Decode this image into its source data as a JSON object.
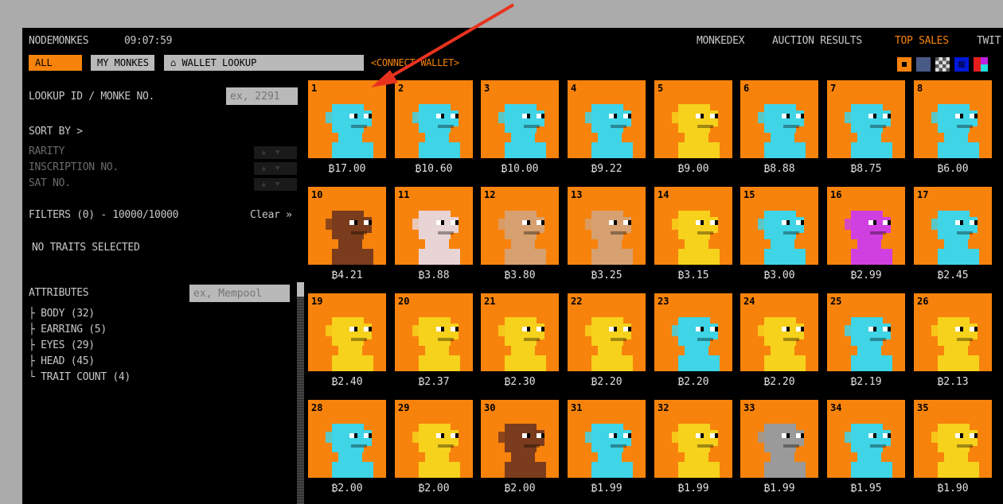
{
  "header": {
    "brand": "NODEMONKES",
    "clock": "09:07:59",
    "nav": [
      {
        "label": "MONKEDEX",
        "active": false
      },
      {
        "label": "AUCTION RESULTS",
        "active": false
      },
      {
        "label": "TOP SALES",
        "active": true
      },
      {
        "label": "TWIT",
        "active": false
      }
    ],
    "tabs": {
      "all": "ALL",
      "my": "MY MONKES",
      "wallet": "⌂ WALLET LOOKUP"
    },
    "connect": "<CONNECT WALLET>",
    "themes": [
      {
        "name": "orange",
        "color": "#f7830c"
      },
      {
        "name": "slate",
        "color": "#4a5a86"
      },
      {
        "name": "checker",
        "color": "#bbbbbb"
      },
      {
        "name": "blue",
        "color": "#0018d8"
      },
      {
        "name": "multi",
        "color": "#e0208a"
      }
    ]
  },
  "sidebar": {
    "lookup_label": "LOOKUP ID / MONKE NO.",
    "lookup_placeholder": "ex, 2291",
    "sort_label": "SORT BY >",
    "sort_items": [
      "RARITY",
      "INSCRIPTION NO.",
      "SAT NO."
    ],
    "filters": "FILTERS (0) - 10000/10000",
    "clear": "Clear »",
    "no_traits": "NO TRAITS SELECTED",
    "attributes_label": "ATTRIBUTES",
    "attributes_placeholder": "ex, Mempool",
    "attributes": [
      "BODY (32)",
      "EARRING (5)",
      "EYES (29)",
      "HEAD (45)",
      "TRAIT COUNT (4)"
    ]
  },
  "grid": [
    [
      {
        "n": "1",
        "p": "₿17.00",
        "c": "#3fd4e6"
      },
      {
        "n": "2",
        "p": "₿10.60",
        "c": "#3fd4e6"
      },
      {
        "n": "3",
        "p": "₿10.00",
        "c": "#3fd4e6"
      },
      {
        "n": "4",
        "p": "₿9.22",
        "c": "#3fd4e6"
      },
      {
        "n": "5",
        "p": "₿9.00",
        "c": "#f6d21c"
      },
      {
        "n": "6",
        "p": "₿8.88",
        "c": "#3fd4e6"
      },
      {
        "n": "7",
        "p": "₿8.75",
        "c": "#3fd4e6"
      },
      {
        "n": "8",
        "p": "₿6.00",
        "c": "#3fd4e6"
      }
    ],
    [
      {
        "n": "10",
        "p": "₿4.21",
        "c": "#7a3c1c"
      },
      {
        "n": "11",
        "p": "₿3.88",
        "c": "#e8d4d4"
      },
      {
        "n": "12",
        "p": "₿3.80",
        "c": "#d6a070"
      },
      {
        "n": "13",
        "p": "₿3.25",
        "c": "#d6a070"
      },
      {
        "n": "14",
        "p": "₿3.15",
        "c": "#f6d21c"
      },
      {
        "n": "15",
        "p": "₿3.00",
        "c": "#3fd4e6"
      },
      {
        "n": "16",
        "p": "₿2.99",
        "c": "#d040e0"
      },
      {
        "n": "17",
        "p": "₿2.45",
        "c": "#3fd4e6"
      }
    ],
    [
      {
        "n": "19",
        "p": "₿2.40",
        "c": "#f6d21c"
      },
      {
        "n": "20",
        "p": "₿2.37",
        "c": "#f6d21c"
      },
      {
        "n": "21",
        "p": "₿2.30",
        "c": "#f6d21c"
      },
      {
        "n": "22",
        "p": "₿2.20",
        "c": "#f6d21c"
      },
      {
        "n": "23",
        "p": "₿2.20",
        "c": "#3fd4e6"
      },
      {
        "n": "24",
        "p": "₿2.20",
        "c": "#f6d21c"
      },
      {
        "n": "25",
        "p": "₿2.19",
        "c": "#3fd4e6"
      },
      {
        "n": "26",
        "p": "₿2.13",
        "c": "#f6d21c"
      }
    ],
    [
      {
        "n": "28",
        "p": "₿2.00",
        "c": "#3fd4e6"
      },
      {
        "n": "29",
        "p": "₿2.00",
        "c": "#f6d21c"
      },
      {
        "n": "30",
        "p": "₿2.00",
        "c": "#7a3c1c"
      },
      {
        "n": "31",
        "p": "₿1.99",
        "c": "#3fd4e6"
      },
      {
        "n": "32",
        "p": "₿1.99",
        "c": "#f6d21c"
      },
      {
        "n": "33",
        "p": "₿1.99",
        "c": "#9a9a9a"
      },
      {
        "n": "34",
        "p": "₿1.95",
        "c": "#3fd4e6"
      },
      {
        "n": "35",
        "p": "₿1.90",
        "c": "#f6d21c"
      }
    ]
  ],
  "colors": {
    "accent": "#f7830c",
    "annotation_arrow": "#e8321e"
  }
}
